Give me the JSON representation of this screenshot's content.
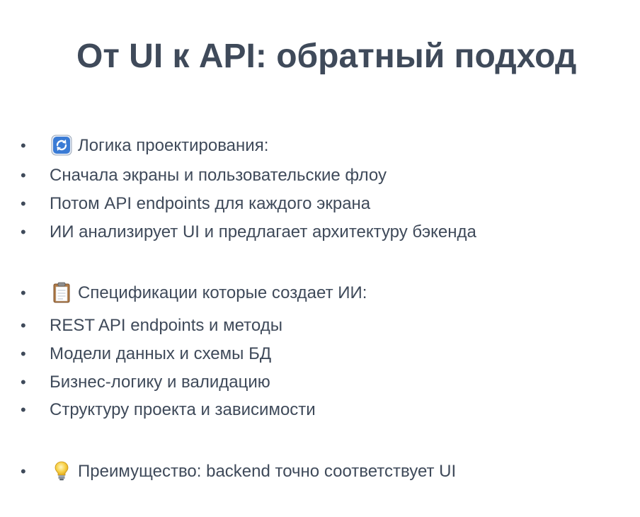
{
  "slide": {
    "title": "От UI к API: обратный подход",
    "bullet_symbol": "•",
    "groups": [
      {
        "icon": "arrows-cycle-icon",
        "heading": "Логика проектирования:",
        "items": [
          "Сначала экраны и пользовательские флоу",
          "Потом API endpoints для каждого экрана",
          "ИИ анализирует UI и предлагает архитектуру бэкенда"
        ]
      },
      {
        "icon": "clipboard-icon",
        "heading": "Спецификации которые создает ИИ:",
        "items": [
          "REST API endpoints и методы",
          "Модели данных и схемы БД",
          "Бизнес-логику и валидацию",
          "Структуру проекта и зависимости"
        ]
      },
      {
        "icon": "light-bulb-icon",
        "heading": "Преимущество: backend точно соответствует UI",
        "items": []
      }
    ]
  },
  "colors": {
    "text": "#3f4a5a",
    "background": "#ffffff",
    "cycle_icon_blue": "#3a7bd5",
    "clipboard_brown": "#b07a45",
    "bulb_yellow": "#f7d046"
  }
}
